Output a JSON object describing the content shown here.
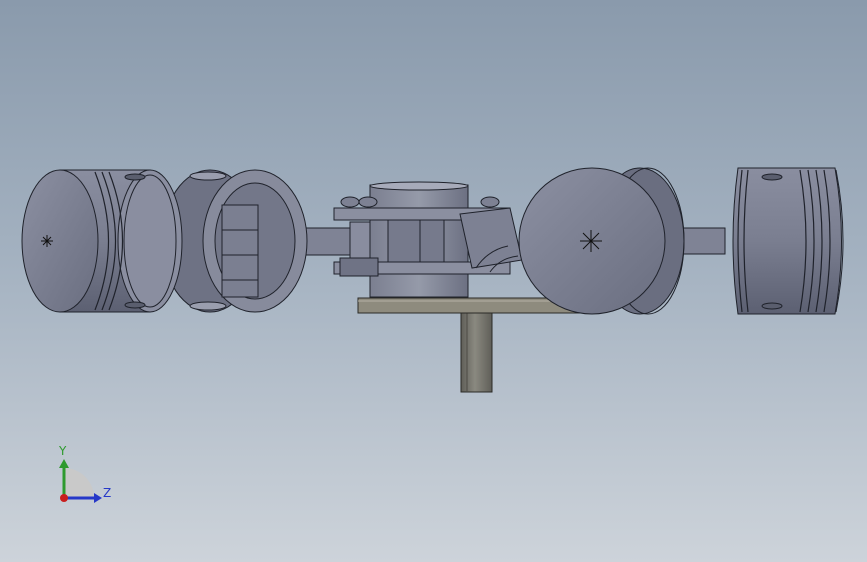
{
  "window": {
    "title": ""
  },
  "model": {
    "name": "",
    "components": [
      "piston-left-outer",
      "piston-left-inner",
      "connecting-rod-left",
      "crank-block",
      "connecting-rod-right",
      "piston-right-crown",
      "piston-right-outer",
      "base-plate",
      "crank-shaft"
    ]
  },
  "triad": {
    "y_label": "Y",
    "z_label": "Z",
    "colors": {
      "y": "#2e9a2e",
      "z": "#2638c8",
      "x": "#c81e1e"
    }
  },
  "colors": {
    "background_top": "#8a9aac",
    "background_bottom": "#cdd3da",
    "part_dark": "#4a4f5e",
    "part_mid": "#7d8294",
    "part_light": "#9ea2b2",
    "base_plate": "#8e8b7e",
    "shaft": "#77766f",
    "edge": "#1f222b"
  }
}
